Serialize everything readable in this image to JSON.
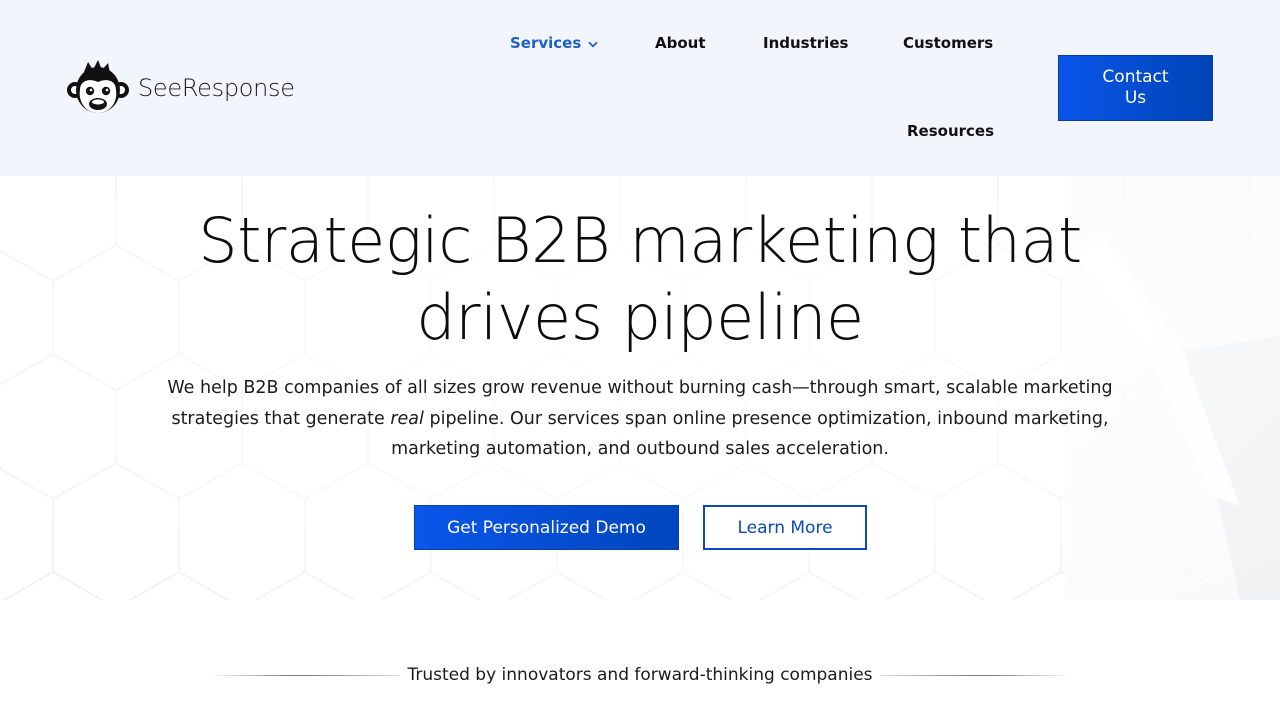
{
  "brand": {
    "name": "SeeResponse",
    "logo_icon": "monkey-face-icon"
  },
  "nav": {
    "items": [
      {
        "label": "Services",
        "active": true,
        "has_dropdown": true
      },
      {
        "label": "About"
      },
      {
        "label": "Industries"
      },
      {
        "label": "Customers"
      },
      {
        "label": "Resources"
      }
    ],
    "contact_label": "Contact Us"
  },
  "hero": {
    "headline": "Strategic B2B marketing that drives pipeline",
    "subtext_before": "We help B2B companies of all sizes grow revenue without burning cash—through smart, scalable marketing strategies that generate ",
    "subtext_em": "real",
    "subtext_after": " pipeline. Our services span online presence optimization, inbound marketing, marketing automation, and outbound sales acceleration.",
    "primary_cta": "Get Personalized Demo",
    "secondary_cta": "Learn More"
  },
  "trusted": {
    "text": "Trusted by innovators and forward-thinking companies"
  },
  "colors": {
    "header_bg": "#f2f6fc",
    "accent": "#1f5fc9",
    "button_blue": "#0a56ea"
  }
}
